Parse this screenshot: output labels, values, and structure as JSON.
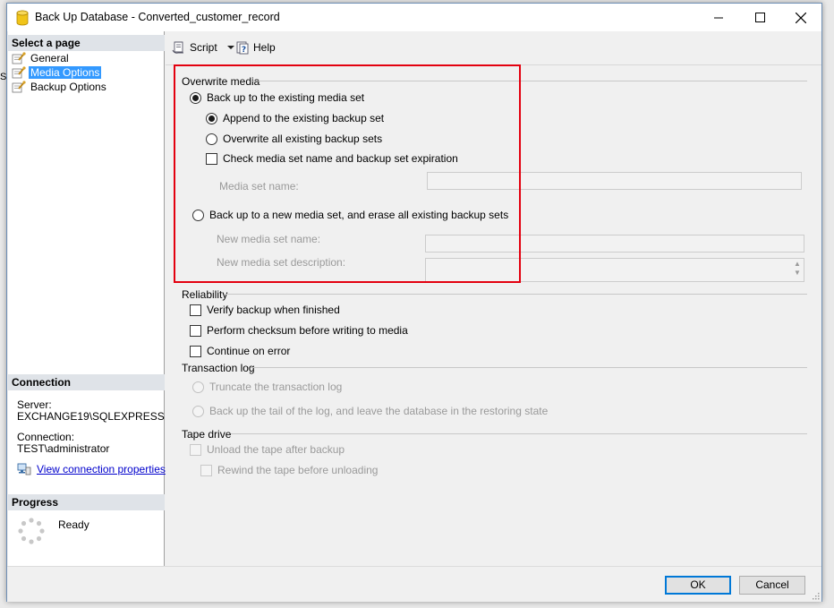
{
  "window": {
    "title": "Back Up Database - Converted_customer_record",
    "icon": "database-icon",
    "behind_text": "ST"
  },
  "left_pane": {
    "select_page_header": "Select a page",
    "pages": [
      {
        "label": "General",
        "icon": "page-wrench-icon",
        "selected": false
      },
      {
        "label": "Media Options",
        "icon": "page-wrench-icon",
        "selected": true
      },
      {
        "label": "Backup Options",
        "icon": "page-wrench-icon",
        "selected": false
      }
    ],
    "connection_header": "Connection",
    "server_label": "Server:",
    "server_value": "EXCHANGE19\\SQLEXPRESS",
    "connection_label": "Connection:",
    "connection_value": "TEST\\administrator",
    "view_connection_link": "View connection properties",
    "progress_header": "Progress",
    "progress_status": "Ready"
  },
  "toolbar": {
    "script_label": "Script",
    "help_label": "Help"
  },
  "overwrite_media": {
    "title": "Overwrite media",
    "existing_media_set": "Back up to the existing media set",
    "append": "Append to the existing backup set",
    "overwrite_all": "Overwrite all existing backup sets",
    "check_media": "Check media set name and backup set expiration",
    "media_set_name_label": "Media set name:",
    "media_set_name_value": "",
    "new_media_set": "Back up to a new media set, and erase all existing backup sets",
    "new_media_set_name_label": "New media set name:",
    "new_media_set_name_value": "",
    "new_media_set_desc_label": "New media set description:",
    "new_media_set_desc_value": ""
  },
  "reliability": {
    "title": "Reliability",
    "verify": "Verify backup when finished",
    "checksum": "Perform checksum before writing to media",
    "continue_on_error": "Continue on error"
  },
  "transaction_log": {
    "title": "Transaction log",
    "truncate": "Truncate the transaction log",
    "tail": "Back up the tail of the log, and leave the database in the restoring state"
  },
  "tape_drive": {
    "title": "Tape drive",
    "unload": "Unload the tape after backup",
    "rewind": "Rewind the tape before unloading"
  },
  "footer": {
    "ok_label": "OK",
    "cancel_label": "Cancel"
  },
  "colors": {
    "selection": "#3399ff",
    "highlight_border": "#e3000f",
    "link": "#0000cc"
  }
}
